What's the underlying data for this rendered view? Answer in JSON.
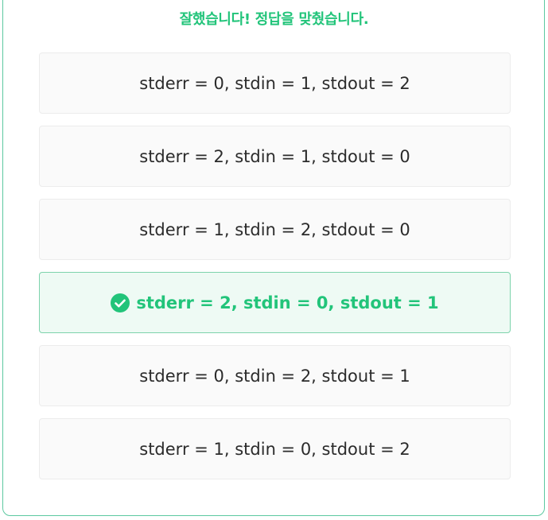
{
  "result": {
    "message": "잘했습니다! 정답을 맞췄습니다."
  },
  "options": [
    {
      "label": "stderr = 0, stdin = 1, stdout = 2",
      "correct": false
    },
    {
      "label": "stderr = 2, stdin = 1, stdout = 0",
      "correct": false
    },
    {
      "label": "stderr = 1, stdin = 2, stdout = 0",
      "correct": false
    },
    {
      "label": "stderr = 2, stdin = 0, stdout = 1",
      "correct": true
    },
    {
      "label": "stderr = 0, stdin = 2, stdout = 1",
      "correct": false
    },
    {
      "label": "stderr = 1, stdin = 0, stdout = 2",
      "correct": false
    }
  ],
  "colors": {
    "accent": "#22c47a",
    "border": "#5cc9a0",
    "correct_bg": "#eefaf4"
  },
  "icons": {
    "correct": "check-circle-icon"
  }
}
